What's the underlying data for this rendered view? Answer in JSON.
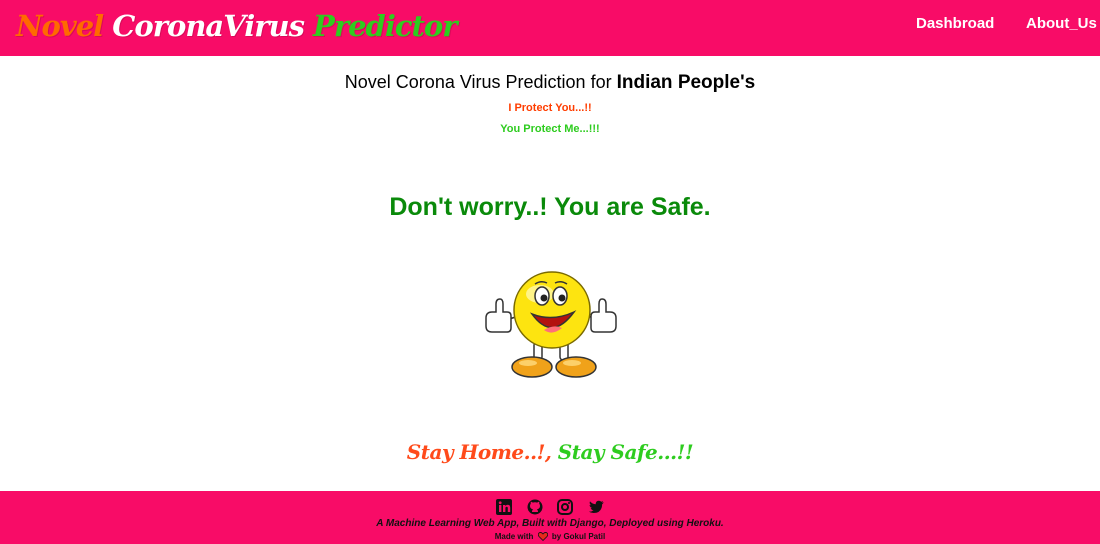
{
  "navbar": {
    "brand": {
      "part1": "Novel",
      "part2": "CoronaVirus",
      "part3": "Predictor"
    },
    "links": [
      {
        "label": "Dashbroad"
      },
      {
        "label": "About_Us"
      }
    ]
  },
  "main": {
    "heading_prefix": "Novel Corona Virus Prediction for",
    "heading_emphasis": "Indian People's",
    "tagline1": "I Protect You...!!",
    "tagline2": "You Protect Me...!!!",
    "result": "Don't worry..! You are Safe.",
    "slogan_part1": "Stay Home..!,",
    "slogan_part2": "Stay Safe...!!"
  },
  "footer": {
    "social_icons": [
      "linkedin-icon",
      "github-icon",
      "instagram-icon",
      "twitter-icon"
    ],
    "description": "A Machine Learning Web App, Built with Django, Deployed using Heroku.",
    "made_with": "Made with",
    "by": "by Gokul Patil"
  },
  "colors": {
    "brand_pink": "#f80c67",
    "orange": "#ff6a00",
    "green": "#2ecc1f",
    "result_green": "#0a8a0a"
  }
}
